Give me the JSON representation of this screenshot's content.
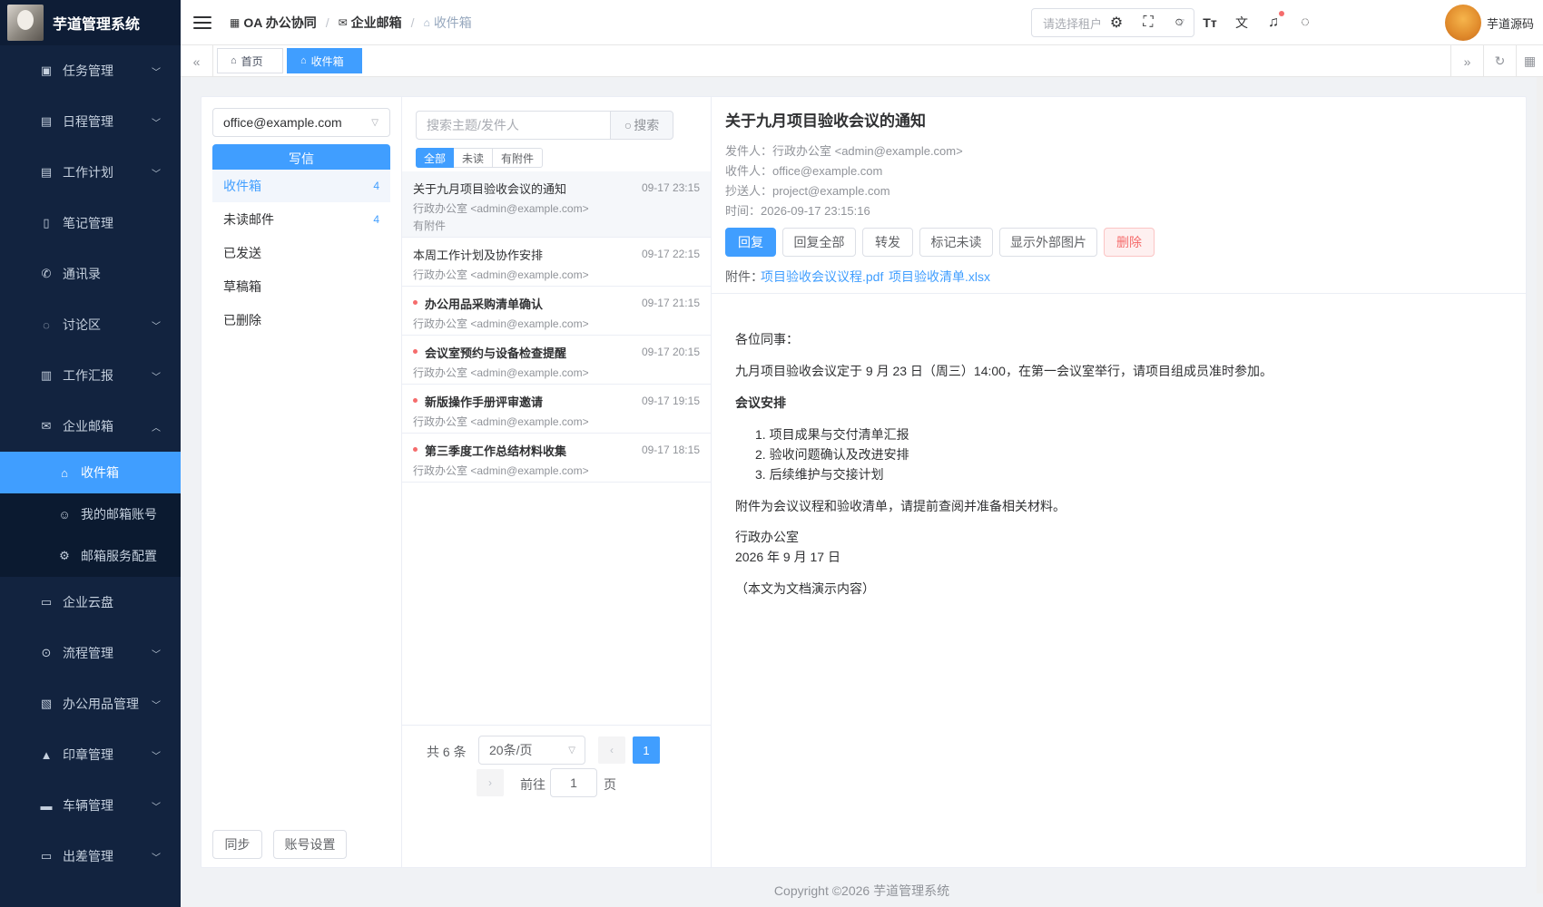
{
  "app": {
    "title": "芋道管理系统"
  },
  "sidebar": {
    "items": [
      {
        "label": "任务管理",
        "icon": "task-icon",
        "arrow": "down"
      },
      {
        "label": "日程管理",
        "icon": "calendar-icon",
        "arrow": "down"
      },
      {
        "label": "工作计划",
        "icon": "calendar-icon",
        "arrow": "down"
      },
      {
        "label": "笔记管理",
        "icon": "notebook-icon",
        "arrow": ""
      },
      {
        "label": "通讯录",
        "icon": "phone-icon",
        "arrow": ""
      },
      {
        "label": "讨论区",
        "icon": "chat-icon",
        "arrow": "down"
      },
      {
        "label": "工作汇报",
        "icon": "report-icon",
        "arrow": "down"
      },
      {
        "label": "企业邮箱",
        "icon": "mail-icon",
        "arrow": "up"
      }
    ],
    "sub_items": [
      {
        "label": "收件箱",
        "icon": "inbox-icon",
        "active": true
      },
      {
        "label": "我的邮箱账号",
        "icon": "user-icon",
        "active": false
      },
      {
        "label": "邮箱服务配置",
        "icon": "gear-icon",
        "active": false
      }
    ],
    "items_after": [
      {
        "label": "企业云盘",
        "icon": "folder-icon",
        "arrow": ""
      },
      {
        "label": "流程管理",
        "icon": "workflow-icon",
        "arrow": "down"
      },
      {
        "label": "办公用品管理",
        "icon": "supplies-icon",
        "arrow": "down"
      },
      {
        "label": "印章管理",
        "icon": "stamp-icon",
        "arrow": "down"
      },
      {
        "label": "车辆管理",
        "icon": "vehicle-icon",
        "arrow": "down"
      },
      {
        "label": "出差管理",
        "icon": "briefcase-icon",
        "arrow": "down"
      }
    ]
  },
  "header": {
    "breadcrumb": [
      "OA 办公协同",
      "企业邮箱",
      "收件箱"
    ],
    "tenant_placeholder": "请选择租户",
    "user_name": "芋道源码"
  },
  "tags": [
    {
      "label": "首页"
    },
    {
      "label": "收件箱"
    }
  ],
  "mailbox": {
    "account": "office@example.com",
    "write_label": "写信",
    "folders": [
      {
        "label": "收件箱",
        "count": "4"
      },
      {
        "label": "未读邮件",
        "count": "4"
      },
      {
        "label": "已发送",
        "count": ""
      },
      {
        "label": "草稿箱",
        "count": ""
      },
      {
        "label": "已删除",
        "count": ""
      }
    ],
    "sync_label": "同步",
    "account_settings_label": "账号设置"
  },
  "list": {
    "search_placeholder": "搜索主题/发件人",
    "search_label": "搜索",
    "filters": [
      "全部",
      "未读",
      "有附件"
    ],
    "items": [
      {
        "subject": "关于九月项目验收会议的通知",
        "time": "09-17 23:15",
        "from": "行政办公室 <admin@example.com>",
        "attach": "有附件",
        "unread": false
      },
      {
        "subject": "本周工作计划及协作安排",
        "time": "09-17 22:15",
        "from": "行政办公室 <admin@example.com>",
        "attach": "",
        "unread": false
      },
      {
        "subject": "办公用品采购清单确认",
        "time": "09-17 21:15",
        "from": "行政办公室 <admin@example.com>",
        "attach": "",
        "unread": true
      },
      {
        "subject": "会议室预约与设备检查提醒",
        "time": "09-17 20:15",
        "from": "行政办公室 <admin@example.com>",
        "attach": "",
        "unread": true
      },
      {
        "subject": "新版操作手册评审邀请",
        "time": "09-17 19:15",
        "from": "行政办公室 <admin@example.com>",
        "attach": "",
        "unread": true
      },
      {
        "subject": "第三季度工作总结材料收集",
        "time": "09-17 18:15",
        "from": "行政办公室 <admin@example.com>",
        "attach": "",
        "unread": true
      }
    ],
    "pagination": {
      "total": "共 6 条",
      "page_size": "20条/页",
      "current": "1",
      "goto_label": "前往",
      "goto_value": "1",
      "page_label": "页"
    }
  },
  "detail": {
    "subject": "关于九月项目验收会议的通知",
    "from": "发件人：行政办公室 <admin@example.com>",
    "to": "收件人：office@example.com",
    "cc": "抄送人：project@example.com",
    "time": "时间：2026-09-17 23:15:16",
    "actions": [
      "回复",
      "回复全部",
      "转发",
      "标记未读",
      "显示外部图片",
      "删除"
    ],
    "attach_label": "附件：",
    "attachments": [
      "项目验收会议议程.pdf",
      "项目验收清单.xlsx"
    ],
    "body": {
      "greeting": "各位同事：",
      "para1": "九月项目验收会议定于 9 月 23 日（周三）14:00，在第一会议室举行，请项目组成员准时参加。",
      "heading": "会议安排",
      "list": [
        "1. 项目成果与交付清单汇报",
        "2. 验收问题确认及改进安排",
        "3. 后续维护与交接计划"
      ],
      "para2": "附件为会议议程和验收清单，请提前查阅并准备相关材料。",
      "sign1": "行政办公室",
      "sign2": "2026 年 9 月 17 日",
      "note": "（本文为文档演示内容）"
    }
  },
  "footer": {
    "copyright": "Copyright ©2026 芋道管理系统"
  },
  "colors": {
    "primary": "#409eff",
    "sidebar_bg": "#12233f",
    "danger": "#f56c6c"
  }
}
